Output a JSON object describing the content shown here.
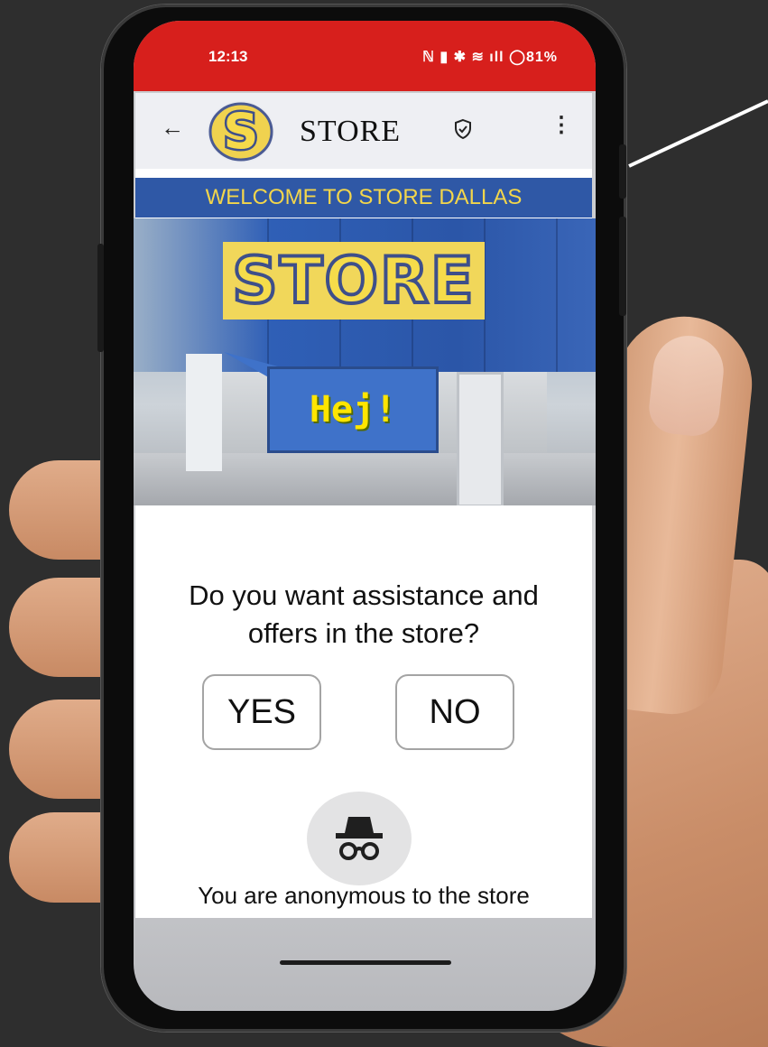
{
  "status_bar": {
    "time": "12:13",
    "icons_text": "ℕ ▮ ✱ ≋ ıll ◯81%"
  },
  "app_bar": {
    "back_icon": "←",
    "title": "STORE",
    "menu_icon": "⋮",
    "logo_letter": "S"
  },
  "banner": {
    "welcome": "WELCOME TO STORE DALLAS",
    "store_sign": "STORE",
    "greeting": "Hej!"
  },
  "prompt": {
    "question_line1": "Do you want assistance and",
    "question_line2": "offers in the store?",
    "yes_label": "YES",
    "no_label": "NO",
    "anonymous_text": "You are anonymous to the store"
  },
  "colors": {
    "status_bar": "#d71f1c",
    "welcome_bar": "#2f58a6",
    "welcome_text": "#f3d64b",
    "sign_yellow": "#f1d75a",
    "sign_outline": "#3e4f8a",
    "hej_text": "#ffe500",
    "hej_box": "#3f72c9"
  },
  "icons": [
    "arrow-left-icon",
    "store-logo-icon",
    "shield-check-icon",
    "more-vert-icon",
    "incognito-icon"
  ]
}
